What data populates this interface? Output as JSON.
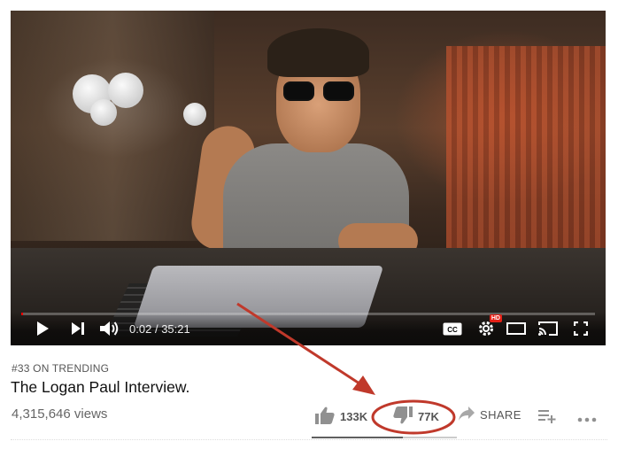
{
  "player": {
    "time_current": "0:02",
    "time_total": "35:21",
    "time_separator": "/",
    "progress_fraction": 0.001,
    "icons": {
      "play": "play-icon",
      "next": "next-icon",
      "volume": "volume-icon",
      "captions": "captions-icon",
      "settings": "settings-gear-icon",
      "miniplayer": "miniplayer-icon",
      "cast": "cast-icon",
      "fullscreen": "fullscreen-icon"
    },
    "captions_label": "CC",
    "hd_badge": "HD"
  },
  "info": {
    "trending": "#33 ON TRENDING",
    "title": "The Logan Paul Interview.",
    "views": "4,315,646 views"
  },
  "actions": {
    "like_count": "133K",
    "dislike_count": "77K",
    "share_label": "SHARE",
    "like_fraction": 0.63
  },
  "annotation": {
    "color": "#c0392b"
  },
  "colors": {
    "progress": "#ff0000",
    "hd": "#e62117"
  }
}
